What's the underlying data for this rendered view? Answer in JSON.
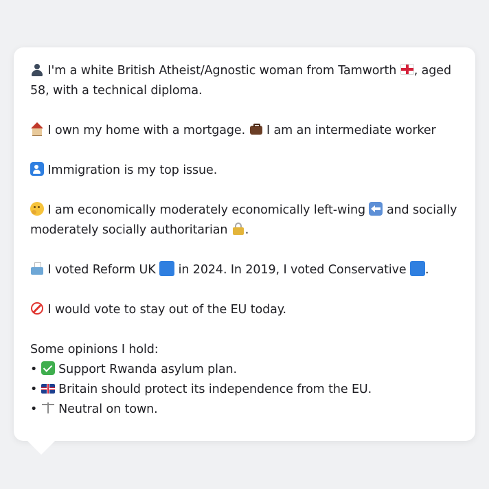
{
  "colors": {
    "page_background": "#f0f1f3",
    "card_background": "#ffffff",
    "text": "#1f1f24"
  },
  "profile": {
    "p1": {
      "icon": "person-silhouette-icon",
      "text_a": "I'm a white British Atheist/Agnostic woman from Tamworth",
      "flag_icon": "england-flag-icon",
      "text_b": ", aged 58, with a technical diploma."
    },
    "p2": {
      "icon": "house-icon",
      "text_a": "I own my home with a mortgage.",
      "work_icon": "briefcase-icon",
      "text_b": "I am an intermediate worker"
    },
    "p3": {
      "icon": "passport-control-icon",
      "text": "Immigration is my top issue."
    },
    "p4": {
      "icon": "thinking-face-icon",
      "text_a": "I am economically moderately economically left-wing",
      "left_icon": "left-arrow-icon",
      "text_b": "and socially moderately socially authoritarian",
      "auth_icon": "lock-icon",
      "text_c": "."
    },
    "p5": {
      "icon": "ballot-box-icon",
      "text_a": "I voted Reform UK",
      "party1_icon": "blue-square-icon",
      "text_b": "in 2024. In 2019, I voted Conservative",
      "party2_icon": "blue-square-icon",
      "text_c": "."
    },
    "p6": {
      "icon": "prohibited-icon",
      "text": "I would vote to stay out of the EU today."
    },
    "opinions": {
      "heading": "Some opinions I hold:",
      "bullet": "•",
      "items": [
        {
          "icon": "check-mark-icon",
          "text": "Support Rwanda asylum plan."
        },
        {
          "icon": "union-jack-flag-icon",
          "text": "Britain should protect its independence from the EU."
        },
        {
          "icon": "balance-scale-icon",
          "text": "Neutral on town."
        }
      ]
    }
  }
}
